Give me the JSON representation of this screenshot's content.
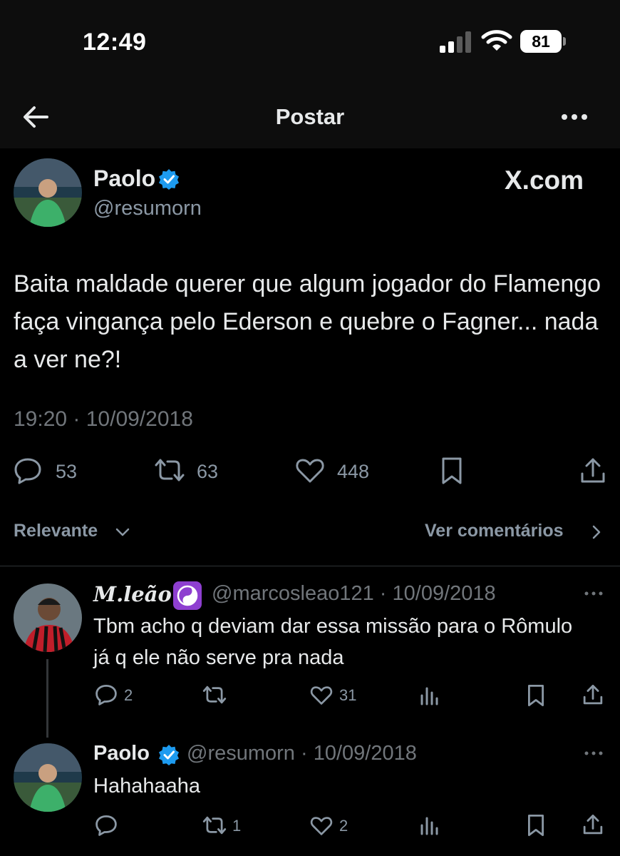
{
  "status_bar": {
    "time": "12:49",
    "battery": "81"
  },
  "nav": {
    "title": "Postar"
  },
  "post": {
    "name": "Paolo",
    "handle": "@resumorn",
    "watermark": "X.com",
    "text": "Baita maldade querer que algum jogador do Flamengo faça vingança pelo Ederson e quebre o Fagner... nada a ver ne?!",
    "timestamp": "19:20 · 10/09/2018",
    "replies": "53",
    "reposts": "63",
    "likes": "448"
  },
  "sort": {
    "label": "Relevante",
    "view_comments": "Ver comentários"
  },
  "replies": [
    {
      "name": "M.leão",
      "handle": "@marcosleao121",
      "date": "10/09/2018",
      "text": "Tbm acho q deviam dar essa missão para o Rômulo já q ele não serve pra nada",
      "replies": "2",
      "reposts": "",
      "likes": "31"
    },
    {
      "name": "Paolo",
      "handle": "@resumorn",
      "date": "10/09/2018",
      "text": "Hahahaaha",
      "replies": "",
      "reposts": "1",
      "likes": "2"
    }
  ],
  "icons": {
    "back": "arrow-left-icon",
    "more": "more-horizontal-icon",
    "verified": "verified-badge-icon",
    "reply": "reply-bubble-icon",
    "repost": "repost-icon",
    "like": "heart-icon",
    "bookmark": "bookmark-icon",
    "share": "share-icon",
    "views": "views-bars-icon",
    "emoji": "yin-yang-icon"
  },
  "colors": {
    "background": "#000000",
    "text": "#e7e9ea",
    "secondary": "#71767b",
    "verified": "#1d9bf0",
    "emoji_bg": "#8e3fd0"
  }
}
